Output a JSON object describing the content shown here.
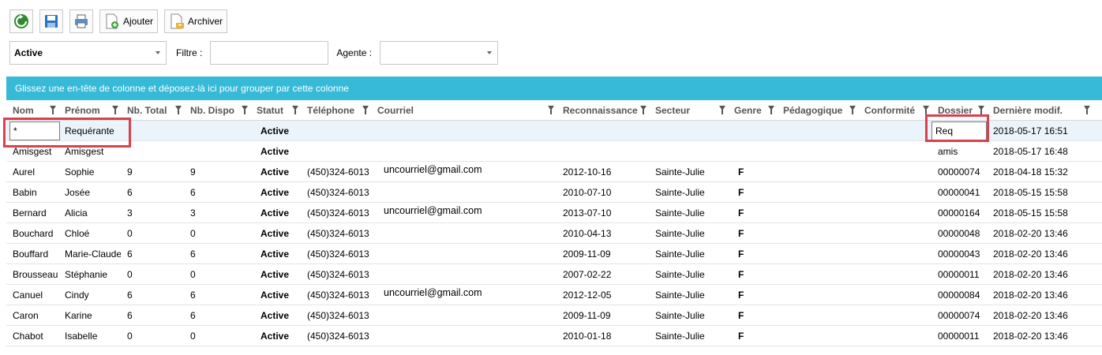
{
  "toolbar": {
    "refresh_icon": "refresh-icon",
    "save_icon": "save-icon",
    "print_icon": "print-icon",
    "add_label": "Ajouter",
    "archive_label": "Archiver"
  },
  "filters": {
    "status_value": "Active",
    "filter_label": "Filtre :",
    "filter_value": "",
    "agent_label": "Agente :",
    "agent_value": ""
  },
  "group_panel": "Glissez une en-tête de colonne et déposez-là ici pour grouper par cette colonne",
  "columns": [
    "Nom",
    "Prénom",
    "Nb. Total",
    "Nb. Dispo",
    "Statut",
    "Téléphone",
    "Courriel",
    "Reconnaissance",
    "Secteur",
    "Genre",
    "Pédagogique",
    "Conformité",
    "Dossier",
    "Dernière modif."
  ],
  "new_row": {
    "nom": "*",
    "prenom": "Requérante",
    "statut": "Active",
    "dossier": "Req",
    "modif": "2018-05-17 16:51"
  },
  "rows": [
    {
      "nom": "Amisgest",
      "prenom": "Amisgest",
      "total": "",
      "dispo": "",
      "statut": "Active",
      "tel": "",
      "courriel": "",
      "reco": "",
      "secteur": "",
      "genre": "",
      "dossier": "amis",
      "modif": "2018-05-17 16:48"
    },
    {
      "nom": "Aurel",
      "prenom": "Sophie",
      "total": "9",
      "dispo": "9",
      "statut": "Active",
      "tel": "(450)324-6013",
      "courriel": "uncourriel@gmail.com",
      "reco": "2012-10-16",
      "secteur": "Sainte-Julie",
      "genre": "F",
      "dossier": "00000074",
      "modif": "2018-04-18 15:32"
    },
    {
      "nom": "Babin",
      "prenom": "Josée",
      "total": "6",
      "dispo": "6",
      "statut": "Active",
      "tel": "(450)324-6013",
      "courriel": "",
      "reco": "2010-07-10",
      "secteur": "Sainte-Julie",
      "genre": "F",
      "dossier": "00000041",
      "modif": "2018-05-15 15:58"
    },
    {
      "nom": "Bernard",
      "prenom": "Alicia",
      "total": "3",
      "dispo": "3",
      "statut": "Active",
      "tel": "(450)324-6013",
      "courriel": "uncourriel@gmail.com",
      "reco": "2013-07-10",
      "secteur": "Sainte-Julie",
      "genre": "F",
      "dossier": "00000164",
      "modif": "2018-05-15 15:58"
    },
    {
      "nom": "Bouchard",
      "prenom": "Chloé",
      "total": "0",
      "dispo": "0",
      "statut": "Active",
      "tel": "(450)324-6013",
      "courriel": "",
      "reco": "2010-04-13",
      "secteur": "Sainte-Julie",
      "genre": "F",
      "dossier": "00000048",
      "modif": "2018-02-20 13:46"
    },
    {
      "nom": "Bouffard",
      "prenom": "Marie-Claude",
      "total": "6",
      "dispo": "6",
      "statut": "Active",
      "tel": "(450)324-6013",
      "courriel": "",
      "reco": "2009-11-09",
      "secteur": "Sainte-Julie",
      "genre": "F",
      "dossier": "00000043",
      "modif": "2018-02-20 13:46"
    },
    {
      "nom": "Brousseau",
      "prenom": "Stéphanie",
      "total": "0",
      "dispo": "0",
      "statut": "Active",
      "tel": "(450)324-6013",
      "courriel": "",
      "reco": "2007-02-22",
      "secteur": "Sainte-Julie",
      "genre": "F",
      "dossier": "00000011",
      "modif": "2018-02-20 13:46"
    },
    {
      "nom": "Canuel",
      "prenom": "Cindy",
      "total": "6",
      "dispo": "6",
      "statut": "Active",
      "tel": "(450)324-6013",
      "courriel": "uncourriel@gmail.com",
      "reco": "2012-12-05",
      "secteur": "Sainte-Julie",
      "genre": "F",
      "dossier": "00000084",
      "modif": "2018-02-20 13:46"
    },
    {
      "nom": "Caron",
      "prenom": "Karine",
      "total": "6",
      "dispo": "6",
      "statut": "Active",
      "tel": "(450)324-6013",
      "courriel": "",
      "reco": "2009-11-09",
      "secteur": "Sainte-Julie",
      "genre": "F",
      "dossier": "00000074",
      "modif": "2018-02-20 13:46"
    },
    {
      "nom": "Chabot",
      "prenom": "Isabelle",
      "total": "0",
      "dispo": "0",
      "statut": "Active",
      "tel": "(450)324-6013",
      "courriel": "",
      "reco": "2010-01-18",
      "secteur": "Sainte-Julie",
      "genre": "F",
      "dossier": "00000011",
      "modif": "2018-02-20 13:46"
    }
  ],
  "colors": {
    "group_panel": "#36bad8",
    "highlight": "#d8414d",
    "new_row_bg": "#eaf4fa"
  }
}
